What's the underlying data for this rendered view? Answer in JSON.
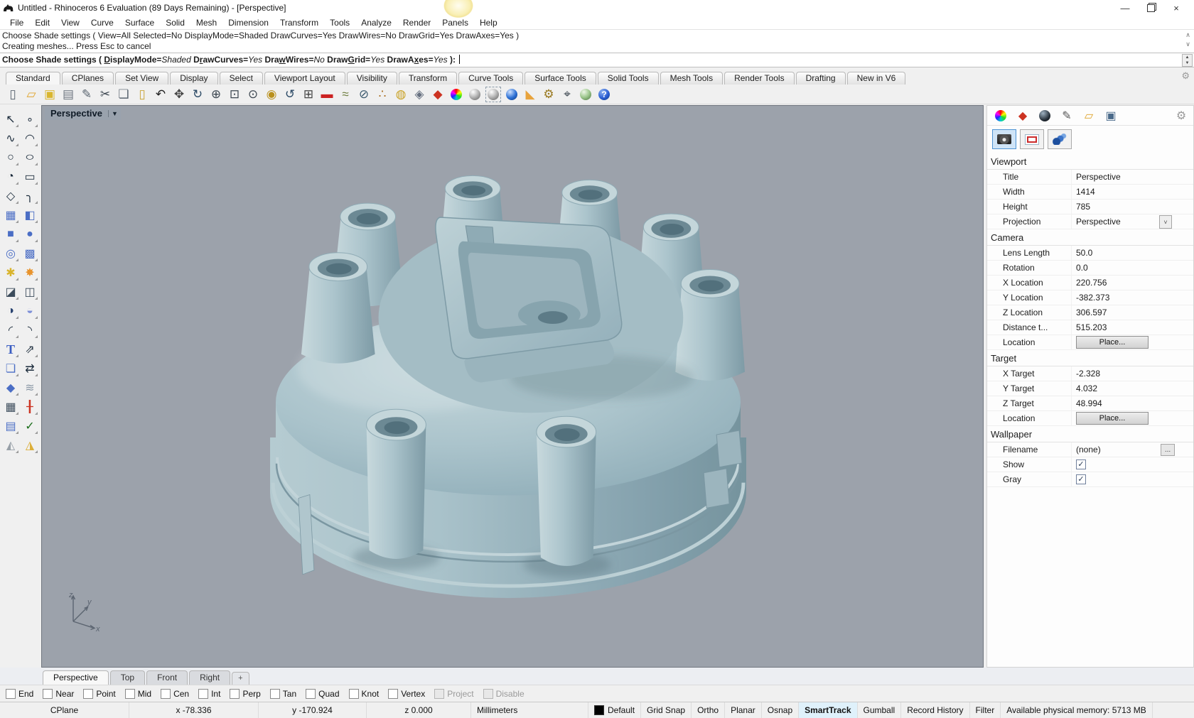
{
  "window": {
    "title": "Untitled - Rhinoceros 6 Evaluation (89 Days Remaining) - [Perspective]",
    "minimize_label": "—",
    "close_label": "×"
  },
  "menu": {
    "items": [
      "File",
      "Edit",
      "View",
      "Curve",
      "Surface",
      "Solid",
      "Mesh",
      "Dimension",
      "Transform",
      "Tools",
      "Analyze",
      "Render",
      "Panels",
      "Help"
    ]
  },
  "command": {
    "history": [
      "Choose Shade settings ( View=All  Selected=No  DisplayMode=Shaded  DrawCurves=Yes  DrawWires=No  DrawGrid=Yes  DrawAxes=Yes )",
      "Creating meshes... Press Esc to cancel"
    ],
    "scroll_up": "∧",
    "scroll_down": "∨",
    "spin_up": "▲",
    "spin_down": "▼",
    "prompt_segments": [
      {
        "t": "Choose Shade settings ( ",
        "cls": "b"
      },
      {
        "t": "D",
        "cls": "bu"
      },
      {
        "t": "isplayMode=",
        "cls": "b"
      },
      {
        "t": "Shaded",
        "cls": "i"
      },
      {
        "t": "  ",
        "cls": "b"
      },
      {
        "t": "D",
        "cls": "b"
      },
      {
        "t": "r",
        "cls": "bu"
      },
      {
        "t": "awCurves=",
        "cls": "b"
      },
      {
        "t": "Yes",
        "cls": "i"
      },
      {
        "t": "  ",
        "cls": "b"
      },
      {
        "t": "Dra",
        "cls": "b"
      },
      {
        "t": "w",
        "cls": "bu"
      },
      {
        "t": "Wires=",
        "cls": "b"
      },
      {
        "t": "No",
        "cls": "i"
      },
      {
        "t": "  ",
        "cls": "b"
      },
      {
        "t": "Draw",
        "cls": "b"
      },
      {
        "t": "G",
        "cls": "bu"
      },
      {
        "t": "rid=",
        "cls": "b"
      },
      {
        "t": "Yes",
        "cls": "i"
      },
      {
        "t": "  ",
        "cls": "b"
      },
      {
        "t": "DrawA",
        "cls": "b"
      },
      {
        "t": "x",
        "cls": "bu"
      },
      {
        "t": "es=",
        "cls": "b"
      },
      {
        "t": "Yes",
        "cls": "i"
      },
      {
        "t": " ): ",
        "cls": "b"
      }
    ]
  },
  "grouptabs": {
    "items": [
      {
        "label": "Standard",
        "active": true
      },
      {
        "label": "CPlanes"
      },
      {
        "label": "Set View"
      },
      {
        "label": "Display"
      },
      {
        "label": "Select"
      },
      {
        "label": "Viewport Layout"
      },
      {
        "label": "Visibility"
      },
      {
        "label": "Transform"
      },
      {
        "label": "Curve Tools"
      },
      {
        "label": "Surface Tools"
      },
      {
        "label": "Solid Tools"
      },
      {
        "label": "Mesh Tools"
      },
      {
        "label": "Render Tools"
      },
      {
        "label": "Drafting"
      },
      {
        "label": "New in V6"
      }
    ],
    "gear": "⚙"
  },
  "toolbar": {
    "items": [
      {
        "name": "new-document",
        "g": "▯",
        "c": "#5a6570"
      },
      {
        "name": "open-file",
        "g": "▱",
        "c": "#e0a52e"
      },
      {
        "name": "save",
        "g": "▣",
        "c": "#d9b62e"
      },
      {
        "name": "print",
        "g": "▤",
        "c": "#6e7680"
      },
      {
        "name": "edit-page",
        "g": "✎",
        "c": "#5a6570"
      },
      {
        "name": "cut",
        "g": "✂",
        "c": "#3c4650"
      },
      {
        "name": "copy",
        "g": "❏",
        "c": "#5a6570"
      },
      {
        "name": "paste",
        "g": "▯",
        "c": "#caa53a"
      },
      {
        "name": "undo",
        "g": "↶",
        "c": "#222222"
      },
      {
        "name": "pan",
        "g": "✥",
        "c": "#444444"
      },
      {
        "name": "rotate-view",
        "g": "↻",
        "c": "#2c4a66"
      },
      {
        "name": "zoom-dynamic",
        "g": "⊕",
        "c": "#3c4650"
      },
      {
        "name": "zoom-window",
        "g": "⊡",
        "c": "#3c4650"
      },
      {
        "name": "zoom-extents",
        "g": "⊙",
        "c": "#3c4650"
      },
      {
        "name": "zoom-selected",
        "g": "◉",
        "c": "#b9901d"
      },
      {
        "name": "undo-view-change",
        "g": "↺",
        "c": "#2c4a66"
      },
      {
        "name": "viewport-layout",
        "g": "⊞",
        "c": "#444444"
      },
      {
        "name": "named-view",
        "g": "▬",
        "c": "#cc2222"
      },
      {
        "name": "analysis",
        "g": "≈",
        "c": "#6a7a3a"
      },
      {
        "name": "hide-object",
        "g": "⊘",
        "c": "#3c5a6e"
      },
      {
        "name": "points-on",
        "g": "∴",
        "c": "#a86a1a"
      },
      {
        "name": "lamp",
        "g": "◍",
        "c": "#c9a227"
      },
      {
        "name": "lock",
        "g": "◈",
        "c": "#667080"
      },
      {
        "name": "layers",
        "g": "◆",
        "c": "#cc3322"
      },
      {
        "name": "object-properties",
        "g": "",
        "c": "",
        "cls": "ico-colorwheel"
      },
      {
        "name": "wireframe-display",
        "g": "",
        "c": "",
        "cls": "ico-grayball"
      },
      {
        "name": "shaded-display",
        "g": "",
        "c": "",
        "cls": "ico-grayball",
        "box": "selbox"
      },
      {
        "name": "rendered-display",
        "g": "",
        "c": "",
        "cls": "ico-blueball"
      },
      {
        "name": "notifications-cone",
        "g": "◣",
        "c": "#e8a33c"
      },
      {
        "name": "options-gear",
        "g": "⚙",
        "c": "#9a7a22"
      },
      {
        "name": "measure-distance",
        "g": "⌖",
        "c": "#3c4650"
      },
      {
        "name": "package-manager-earth",
        "g": "",
        "c": "",
        "cls": "ico-greenball"
      },
      {
        "name": "help",
        "g": "?",
        "c": "#ffffff",
        "cls": "ico-helpball"
      }
    ]
  },
  "lefttools": {
    "items": [
      {
        "name": "select-arrow",
        "g": "↖",
        "c": "#1c2c3c"
      },
      {
        "name": "single-point",
        "g": "∘",
        "c": "#1c2c3c"
      },
      {
        "name": "control-point-curve",
        "g": "∿",
        "c": "#1c2c3c"
      },
      {
        "name": "curve-through-points",
        "g": "◠",
        "c": "#1c2c3c"
      },
      {
        "name": "circle",
        "g": "○",
        "c": "#1c2c3c"
      },
      {
        "name": "ellipse",
        "g": "○",
        "c": "#1c2c3c",
        "cls": "wide"
      },
      {
        "name": "arc",
        "g": "◔",
        "c": "#1c2c3c"
      },
      {
        "name": "rectangle",
        "g": "▭",
        "c": "#1c2c3c"
      },
      {
        "name": "polygon",
        "g": "◇",
        "c": "#1c2c3c"
      },
      {
        "name": "curve-corner",
        "g": "╮",
        "c": "#1c2c3c"
      },
      {
        "name": "surface-from-points",
        "g": "▦",
        "c": "#4b6ec5"
      },
      {
        "name": "surface-patch",
        "g": "◧",
        "c": "#4b6ec5"
      },
      {
        "name": "box",
        "g": "■",
        "c": "#4b6ec5"
      },
      {
        "name": "sphere",
        "g": "●",
        "c": "#4b6ec5"
      },
      {
        "name": "tube",
        "g": "◎",
        "c": "#4b6ec5"
      },
      {
        "name": "revolve-surface",
        "g": "▩",
        "c": "#4b6ec5"
      },
      {
        "name": "join-puzzle",
        "g": "✱",
        "c": "#d9b42c"
      },
      {
        "name": "explode",
        "g": "✸",
        "c": "#e8932c"
      },
      {
        "name": "trim",
        "g": "◪",
        "c": "#3c4c5c"
      },
      {
        "name": "split",
        "g": "◫",
        "c": "#3c4c5c"
      },
      {
        "name": "boolean-union",
        "g": "◑",
        "c": "#25406e"
      },
      {
        "name": "boolean-difference",
        "g": "◒",
        "c": "#7e90d8"
      },
      {
        "name": "fillet-curves",
        "g": "◜",
        "c": "#1c2c3c"
      },
      {
        "name": "blend-curves",
        "g": "◝",
        "c": "#1c2c3c"
      },
      {
        "name": "text-object",
        "g": "T",
        "c": "#3a5dc2",
        "cls": "boldT"
      },
      {
        "name": "scale",
        "g": "⇗",
        "c": "#1c2c3c"
      },
      {
        "name": "copy-objects",
        "g": "❏",
        "c": "#4b6ec5"
      },
      {
        "name": "mirror",
        "g": "⇄",
        "c": "#1c2c3c"
      },
      {
        "name": "boolean-solid-union",
        "g": "◆",
        "c": "#4b6ec5"
      },
      {
        "name": "drape-points",
        "g": "≋",
        "c": "#8b98a6"
      },
      {
        "name": "array-grid",
        "g": "▦",
        "c": "#3c4c5c"
      },
      {
        "name": "array-linear",
        "g": "╂",
        "c": "#cc3322"
      },
      {
        "name": "flow-along-surface",
        "g": "▤",
        "c": "#4b6ec5"
      },
      {
        "name": "check-objects",
        "g": "✓",
        "c": "#1b6e1b"
      },
      {
        "name": "surface-analysis",
        "g": "◭",
        "c": "#98a0a8"
      },
      {
        "name": "environment-map",
        "g": "◮",
        "c": "#dcaf3a"
      }
    ]
  },
  "viewport": {
    "label": "Perspective",
    "dropdown": "▼",
    "axis": {
      "x": "x",
      "y": "y",
      "z": "z"
    }
  },
  "panel": {
    "tabs": [
      {
        "name": "properties-tab",
        "g": "",
        "c": "",
        "cls": "ico-colorwheel"
      },
      {
        "name": "layers-tab",
        "g": "◆",
        "c": "#cc3322"
      },
      {
        "name": "display-tab",
        "g": "",
        "c": "",
        "cls": "ico-blackball"
      },
      {
        "name": "annotate-tab",
        "g": "✎",
        "c": "#555555"
      },
      {
        "name": "files-tab",
        "g": "▱",
        "c": "#e0a52e"
      },
      {
        "name": "rendering-tab",
        "g": "▣",
        "c": "#4a6a8a"
      },
      {
        "name": "panel-settings-gear",
        "g": "⚙",
        "c": "#9a9a9a",
        "push": "push"
      }
    ],
    "modes": [
      {
        "name": "viewport-properties-mode",
        "cls": "ico-camera",
        "sel": true
      },
      {
        "name": "display-mode-settings",
        "cls": "ico-frame"
      },
      {
        "name": "object-properties-mode",
        "cls": "ico-chain"
      }
    ],
    "rows": [
      {
        "kind": "header",
        "label": "Viewport"
      },
      {
        "kind": "text",
        "label": "Title",
        "value": "Perspective"
      },
      {
        "kind": "text",
        "label": "Width",
        "value": "1414",
        "cls": "disabled"
      },
      {
        "kind": "text",
        "label": "Height",
        "value": "785",
        "cls": "disabled"
      },
      {
        "kind": "select",
        "label": "Projection",
        "value": "Perspective",
        "arrow": "˅"
      },
      {
        "kind": "header",
        "label": "Camera"
      },
      {
        "kind": "text",
        "label": "Lens Length",
        "value": "50.0"
      },
      {
        "kind": "text",
        "label": "Rotation",
        "value": "0.0"
      },
      {
        "kind": "text",
        "label": "X Location",
        "value": "220.756"
      },
      {
        "kind": "text",
        "label": "Y Location",
        "value": "-382.373"
      },
      {
        "kind": "text",
        "label": "Z Location",
        "value": "306.597"
      },
      {
        "kind": "text",
        "label": "Distance t...",
        "value": "515.203",
        "cls": "selected"
      },
      {
        "kind": "button",
        "label": "Location",
        "value": "Place..."
      },
      {
        "kind": "header",
        "label": "Target"
      },
      {
        "kind": "text",
        "label": "X Target",
        "value": "-2.328"
      },
      {
        "kind": "text",
        "label": "Y Target",
        "value": "4.032"
      },
      {
        "kind": "text",
        "label": "Z Target",
        "value": "48.994"
      },
      {
        "kind": "button",
        "label": "Location",
        "value": "Place..."
      },
      {
        "kind": "header",
        "label": "Wallpaper"
      },
      {
        "kind": "file",
        "label": "Filename",
        "value": "(none)",
        "button": "..."
      },
      {
        "kind": "check",
        "label": "Show",
        "checked": true
      },
      {
        "kind": "check",
        "label": "Gray",
        "checked": true
      }
    ]
  },
  "pagetabs": {
    "items": [
      {
        "label": "Perspective",
        "active": true
      },
      {
        "label": "Top"
      },
      {
        "label": "Front"
      },
      {
        "label": "Right"
      }
    ],
    "add": "+"
  },
  "osnap": {
    "items": [
      {
        "label": "End"
      },
      {
        "label": "Near"
      },
      {
        "label": "Point"
      },
      {
        "label": "Mid"
      },
      {
        "label": "Cen"
      },
      {
        "label": "Int"
      },
      {
        "label": "Perp"
      },
      {
        "label": "Tan"
      },
      {
        "label": "Quad"
      },
      {
        "label": "Knot"
      },
      {
        "label": "Vertex"
      },
      {
        "label": "Project",
        "disabled": true
      },
      {
        "label": "Disable",
        "disabled": true
      }
    ]
  },
  "statusbar": {
    "items": [
      {
        "label": "CPlane"
      },
      {
        "label": "x -78.336"
      },
      {
        "label": "y -170.924"
      },
      {
        "label": "z 0.000"
      },
      {
        "label": "Millimeters"
      },
      {
        "label": "Default",
        "swatch": "#000000"
      },
      {
        "label": "Grid Snap"
      },
      {
        "label": "Ortho"
      },
      {
        "label": "Planar"
      },
      {
        "label": "Osnap"
      },
      {
        "label": "SmartTrack",
        "active": true
      },
      {
        "label": "Gumball"
      },
      {
        "label": "Record History"
      },
      {
        "label": "Filter"
      },
      {
        "label": "Available physical memory: 5713 MB",
        "info": true
      }
    ]
  },
  "colors": {
    "viewport_bg": "#9ca2ab",
    "model_light": "#c6d8dc",
    "model_base": "#aac3ca",
    "model_dark": "#78969f",
    "accent_selection": "#cfe4f7"
  }
}
